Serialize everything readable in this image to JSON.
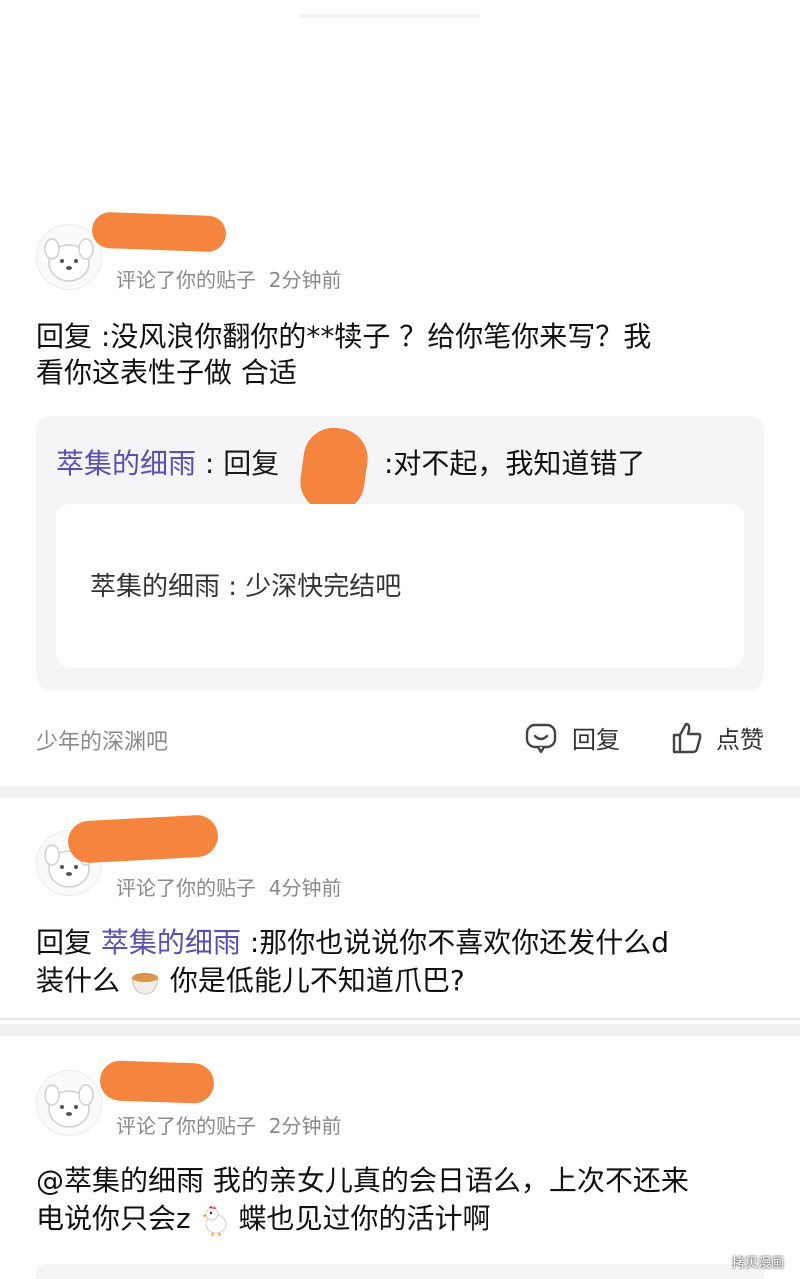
{
  "comments": [
    {
      "meta": "评论了你的贴子",
      "time": "2分钟前",
      "body_line1": "回复  :没风浪你翻你的**犊子   ？给你笔你来写？我",
      "body_line2": "看你这表性子做    合适",
      "quote": {
        "author": "萃集的细雨",
        "text_prefix": " : 回复",
        "text_suffix": ":对不起，我知道错了",
        "inner_text": "萃集的细雨 : 少深快完结吧"
      },
      "footer_source": "少年的深渊吧",
      "reply_label": "回复",
      "like_label": "点赞"
    },
    {
      "meta": "评论了你的贴子",
      "time": "4分钟前",
      "reply_prefix": "回复 ",
      "reply_name": "萃集的细雨",
      "body_line1_rest": "  :那你也说说你不喜欢你还发什么d",
      "body_line2_a": "装什么",
      "body_line2_b": "你是低能儿不知道爪巴?"
    },
    {
      "meta": "评论了你的贴子",
      "time": "2分钟前",
      "body_line1": "@萃集的细雨 我的亲女儿真的会日语么，上次不还来",
      "body_line2_a": "电说你只会z",
      "body_line2_b": " 蝶也见过你的活计啊"
    }
  ],
  "watermark": "拷贝漫画",
  "colors": {
    "redaction": "#f5843e",
    "name_link": "#5c4fb0",
    "meta": "#8a8a8a"
  },
  "icons": [
    "avatar-dog-icon",
    "reply-bubble-icon",
    "thumbs-up-icon",
    "tea-cup-emoji",
    "chicken-emoji"
  ]
}
